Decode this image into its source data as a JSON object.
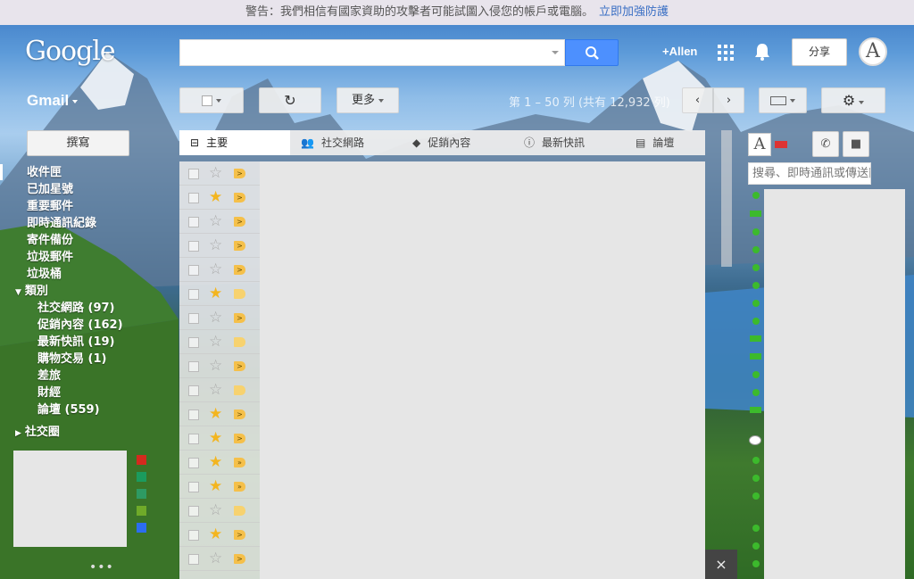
{
  "warning": {
    "text": "警告：我們相信有國家資助的攻擊者可能試圖入侵您的帳戶或電腦。",
    "link": "立即加強防護"
  },
  "header": {
    "logo": "Google",
    "search_placeholder": "",
    "user": "+Allen",
    "share": "分享",
    "avatar_letter": "A"
  },
  "toolbar": {
    "app_label": "Gmail",
    "more_label": "更多",
    "page_info": "第 1 – 50 列 (共有 12,932 列)"
  },
  "sidebar": {
    "compose": "撰寫",
    "items": [
      {
        "label": "收件匣"
      },
      {
        "label": "已加星號"
      },
      {
        "label": "重要郵件"
      },
      {
        "label": "即時通訊紀錄"
      },
      {
        "label": "寄件備份"
      },
      {
        "label": "垃圾郵件"
      },
      {
        "label": "垃圾桶"
      }
    ],
    "category_header": "類別",
    "categories": [
      {
        "label": "社交網路 (97)"
      },
      {
        "label": "促銷內容 (162)"
      },
      {
        "label": "最新快訊 (19)"
      },
      {
        "label": "購物交易 (1)"
      },
      {
        "label": "差旅"
      },
      {
        "label": "財經"
      },
      {
        "label": "論壇 (559)"
      }
    ],
    "circles_header": "社交圈",
    "more_dots": "•••"
  },
  "tabs": [
    {
      "label": "主要",
      "icon": "inbox-icon"
    },
    {
      "label": "社交網路",
      "icon": "people-icon"
    },
    {
      "label": "促銷內容",
      "icon": "tag-icon"
    },
    {
      "label": "最新快訊",
      "icon": "info-icon"
    },
    {
      "label": "論壇",
      "icon": "chat-icon"
    }
  ],
  "rows": [
    {
      "starred": false,
      "marker": ">"
    },
    {
      "starred": true,
      "marker": ">"
    },
    {
      "starred": false,
      "marker": ">"
    },
    {
      "starred": false,
      "marker": ">"
    },
    {
      "starred": false,
      "marker": ">"
    },
    {
      "starred": true,
      "marker": ""
    },
    {
      "starred": false,
      "marker": ">"
    },
    {
      "starred": false,
      "marker": ""
    },
    {
      "starred": false,
      "marker": ">"
    },
    {
      "starred": false,
      "marker": ""
    },
    {
      "starred": true,
      "marker": ">"
    },
    {
      "starred": true,
      "marker": ">"
    },
    {
      "starred": true,
      "marker": "»"
    },
    {
      "starred": true,
      "marker": "»"
    },
    {
      "starred": false,
      "marker": ""
    },
    {
      "starred": true,
      "marker": ">"
    },
    {
      "starred": false,
      "marker": ">"
    }
  ],
  "chat": {
    "search_placeholder": "搜尋、即時通訊或傳送簡訊",
    "avatar_letter": "A"
  },
  "colors": {
    "warn_link": "#3a6fc4",
    "search_button": "#4d90fe",
    "star": "#f3b51f",
    "presence": "#3cba2c",
    "label_colors": [
      "#d42a1e",
      "#1b9b5e",
      "#2e9a63",
      "#6faa29",
      "#2c6df0"
    ]
  },
  "close_glyph": "×"
}
